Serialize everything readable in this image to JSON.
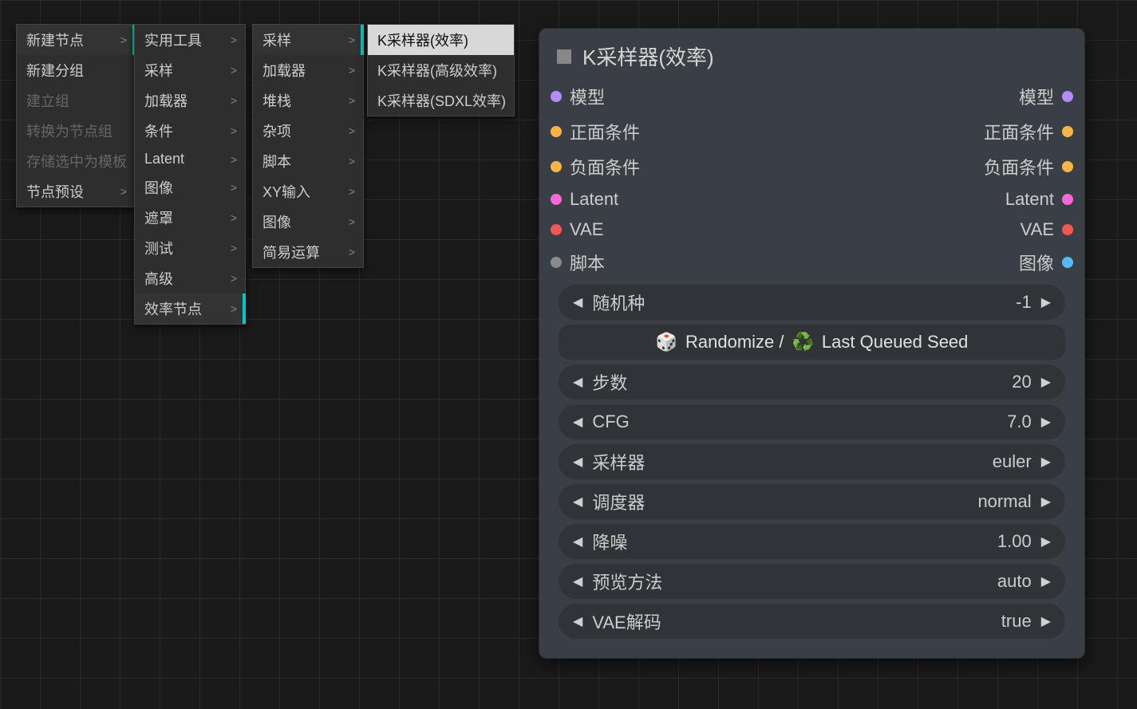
{
  "contextMenu": {
    "col1": [
      {
        "label": "新建节点",
        "hasSub": true,
        "active": true,
        "disabled": false
      },
      {
        "label": "新建分组",
        "hasSub": false,
        "active": false,
        "disabled": false
      },
      {
        "label": "建立组",
        "hasSub": false,
        "active": false,
        "disabled": true
      },
      {
        "label": "转换为节点组",
        "hasSub": false,
        "active": false,
        "disabled": true
      },
      {
        "label": "存储选中为模板",
        "hasSub": false,
        "active": false,
        "disabled": true
      },
      {
        "label": "节点预设",
        "hasSub": true,
        "active": false,
        "disabled": false
      }
    ],
    "col2": [
      {
        "label": "实用工具",
        "hasSub": true
      },
      {
        "label": "采样",
        "hasSub": true
      },
      {
        "label": "加载器",
        "hasSub": true
      },
      {
        "label": "条件",
        "hasSub": true
      },
      {
        "label": "Latent",
        "hasSub": true
      },
      {
        "label": "图像",
        "hasSub": true
      },
      {
        "label": "遮罩",
        "hasSub": true
      },
      {
        "label": "测试",
        "hasSub": true
      },
      {
        "label": "高级",
        "hasSub": true
      },
      {
        "label": "效率节点",
        "hasSub": true,
        "active": true
      }
    ],
    "col3": [
      {
        "label": "采样",
        "hasSub": true,
        "active": true
      },
      {
        "label": "加载器",
        "hasSub": true
      },
      {
        "label": "堆栈",
        "hasSub": true
      },
      {
        "label": "杂项",
        "hasSub": true
      },
      {
        "label": "脚本",
        "hasSub": true
      },
      {
        "label": "XY输入",
        "hasSub": true
      },
      {
        "label": "图像",
        "hasSub": true
      },
      {
        "label": "简易运算",
        "hasSub": true
      }
    ],
    "col4": [
      {
        "label": "K采样器(效率)",
        "highlight": true
      },
      {
        "label": "K采样器(高级效率)"
      },
      {
        "label": "K采样器(SDXL效率)"
      }
    ]
  },
  "node": {
    "title": "K采样器(效率)",
    "inputs": [
      {
        "label": "模型",
        "dotClass": "dot-model"
      },
      {
        "label": "正面条件",
        "dotClass": "dot-pos"
      },
      {
        "label": "负面条件",
        "dotClass": "dot-neg"
      },
      {
        "label": "Latent",
        "dotClass": "dot-latent"
      },
      {
        "label": "VAE",
        "dotClass": "dot-vae"
      },
      {
        "label": "脚本",
        "dotClass": "dot-script"
      }
    ],
    "outputs": [
      {
        "label": "模型",
        "dotClass": "dot-model"
      },
      {
        "label": "正面条件",
        "dotClass": "dot-pos"
      },
      {
        "label": "负面条件",
        "dotClass": "dot-neg"
      },
      {
        "label": "Latent",
        "dotClass": "dot-latent"
      },
      {
        "label": "VAE",
        "dotClass": "dot-vae"
      },
      {
        "label": "图像",
        "dotClass": "dot-image"
      }
    ],
    "params": [
      {
        "name": "seed",
        "label": "随机种",
        "value": "-1"
      },
      {
        "name": "randomize",
        "label": "Randomize /",
        "value": "Last Queued Seed",
        "special": true
      },
      {
        "name": "steps",
        "label": "步数",
        "value": "20"
      },
      {
        "name": "cfg",
        "label": "CFG",
        "value": "7.0"
      },
      {
        "name": "sampler",
        "label": "采样器",
        "value": "euler"
      },
      {
        "name": "scheduler",
        "label": "调度器",
        "value": "normal"
      },
      {
        "name": "denoise",
        "label": "降噪",
        "value": "1.00"
      },
      {
        "name": "preview",
        "label": "预览方法",
        "value": "auto"
      },
      {
        "name": "vaedecode",
        "label": "VAE解码",
        "value": "true"
      }
    ]
  }
}
